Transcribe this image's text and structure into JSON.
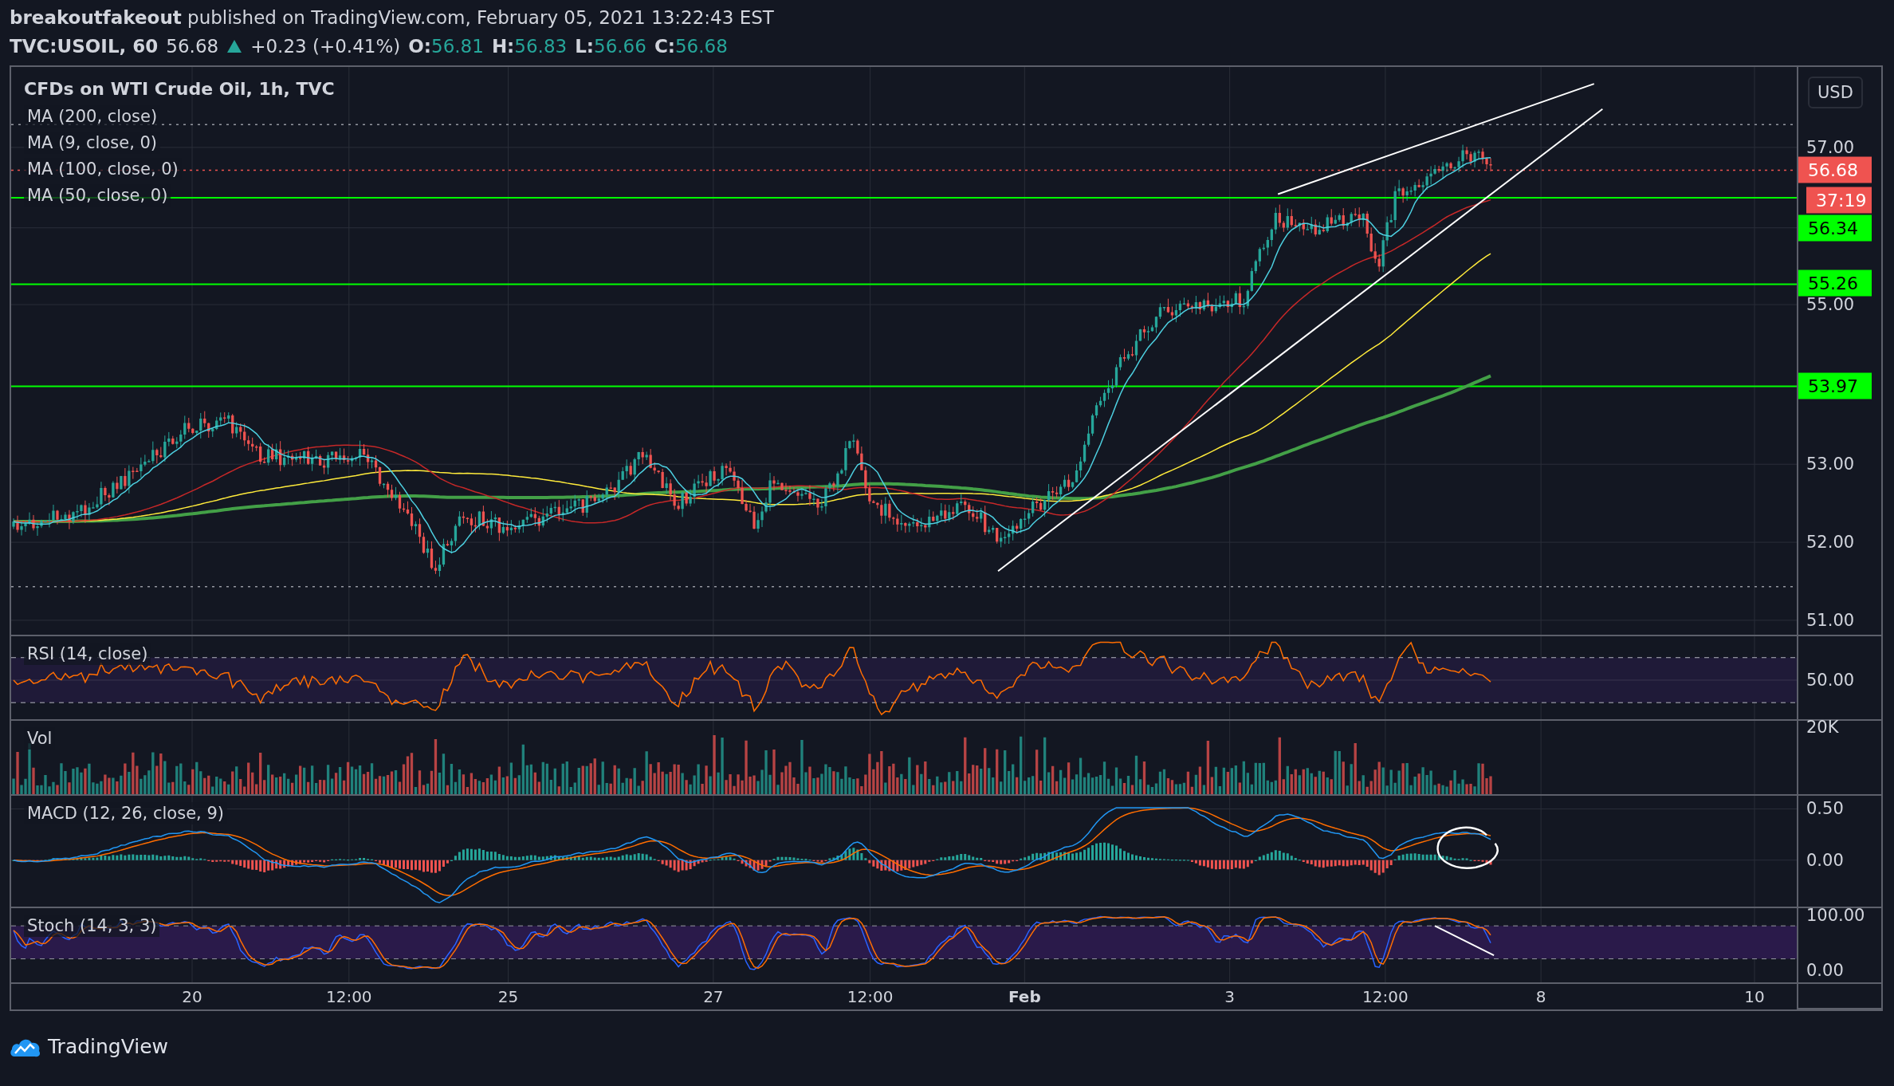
{
  "header": {
    "byline": "**breakoutfakeout** published on TradingView.com, February 05, 2021 13:22:43 EST",
    "symbol": "TVC:USOIL, 60",
    "last": "56.68",
    "change": "+0.23 (+0.41%)",
    "ohlc": [
      {
        "label": "O:",
        "value": "56.81"
      },
      {
        "label": "H:",
        "value": "56.83"
      },
      {
        "label": "L:",
        "value": "56.66"
      },
      {
        "label": "C:",
        "value": "56.68"
      }
    ]
  },
  "main_pane": {
    "title": "CFDs on WTI Crude Oil, 1h, TVC",
    "indicators": [
      "MA (200, close)",
      "MA (9, close, 0)",
      "MA (100, close, 0)",
      "MA (50, close, 0)"
    ],
    "currency_button": "USD",
    "price_axis": [
      {
        "kind": "tick",
        "text": "57.00"
      },
      {
        "kind": "tag",
        "text": "56.68",
        "color": "#ef5350"
      },
      {
        "kind": "tag",
        "text": "37:19",
        "color": "#ef5350"
      },
      {
        "kind": "tag",
        "text": "56.34",
        "color": "#00ff00"
      },
      {
        "kind": "tag",
        "text": "55.26",
        "color": "#00ff00"
      },
      {
        "kind": "tick",
        "text": "55.00"
      },
      {
        "kind": "tag",
        "text": "53.97",
        "color": "#00ff00"
      },
      {
        "kind": "tick",
        "text": "53.00"
      },
      {
        "kind": "tick",
        "text": "52.00"
      },
      {
        "kind": "tick",
        "text": "51.00"
      }
    ]
  },
  "rsi_pane": {
    "title": "RSI (14, close)",
    "axis": [
      "50.00"
    ]
  },
  "volume_pane": {
    "title": "Vol",
    "axis": [
      "20K"
    ]
  },
  "macd_pane": {
    "title": "MACD (12, 26, close, 9)",
    "axis": [
      "0.50",
      "0.00"
    ]
  },
  "stoch_pane": {
    "title": "Stoch (14, 3, 3)",
    "axis": [
      "100.00",
      "0.00"
    ]
  },
  "time_axis": [
    {
      "text": "20",
      "bold": false
    },
    {
      "text": "12:00",
      "bold": false
    },
    {
      "text": "25",
      "bold": false
    },
    {
      "text": "27",
      "bold": false
    },
    {
      "text": "12:00",
      "bold": false
    },
    {
      "text": "Feb",
      "bold": true
    },
    {
      "text": "3",
      "bold": false
    },
    {
      "text": "12:00",
      "bold": false
    },
    {
      "text": "8",
      "bold": false
    },
    {
      "text": "10",
      "bold": false
    }
  ],
  "footer": {
    "brand": "TradingView"
  }
}
